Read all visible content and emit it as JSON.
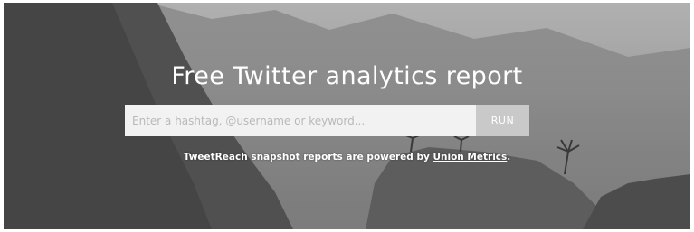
{
  "hero": {
    "title": "Free Twitter analytics report",
    "search": {
      "placeholder": "Enter a hashtag, @username or keyword...",
      "value": ""
    },
    "run_label": "RUN",
    "caption": {
      "prefix": "TweetReach snapshot reports are powered by ",
      "link_text": "Union Metrics",
      "suffix": "."
    }
  },
  "colors": {
    "title_text": "#ffffff",
    "input_bg": "#f2f2f2",
    "run_button_bg": "#c9c9c9"
  },
  "icons": [
    "landscape-background"
  ]
}
